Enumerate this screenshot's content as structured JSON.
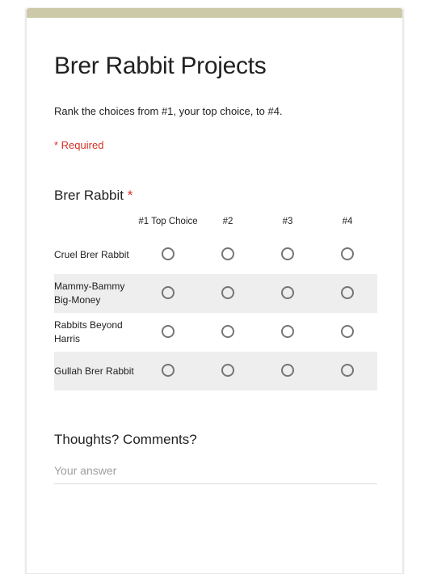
{
  "theme": {
    "header_bar_color": "#ccc9a9",
    "required_color": "#d93025",
    "text_color": "#212121",
    "stripe_color": "#eeeeee",
    "radio_border_color": "#757575",
    "placeholder_color": "#9e9e9e"
  },
  "form": {
    "title": "Brer Rabbit Projects",
    "description": "Rank the choices from #1, your top choice, to #4.",
    "required_note": "* Required"
  },
  "grid_question": {
    "title": "Brer Rabbit",
    "required_marker": "*",
    "columns": [
      {
        "label": "#1 Top Choice"
      },
      {
        "label": "#2"
      },
      {
        "label": "#3"
      },
      {
        "label": "#4"
      }
    ],
    "rows": [
      {
        "label": "Cruel Brer Rabbit",
        "selected": null
      },
      {
        "label": "Mammy-Bammy Big-Money",
        "selected": null
      },
      {
        "label": "Rabbits Beyond Harris",
        "selected": null
      },
      {
        "label": "Gullah Brer Rabbit",
        "selected": null
      }
    ]
  },
  "comments_question": {
    "title": "Thoughts? Comments?",
    "answer_value": "",
    "answer_placeholder": "Your answer"
  }
}
